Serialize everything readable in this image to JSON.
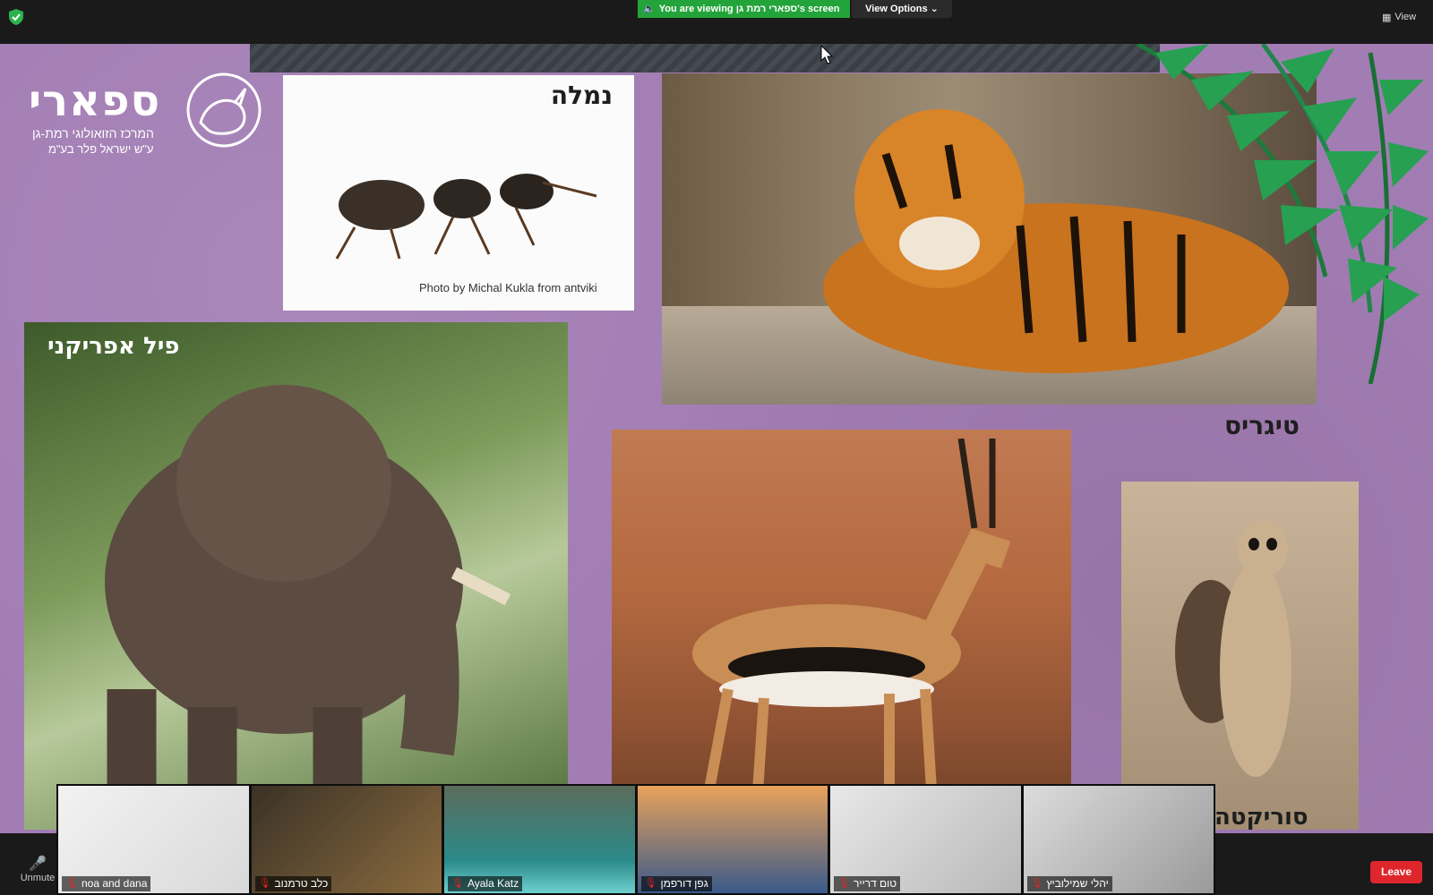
{
  "topbar": {
    "share_banner": "You are viewing ספארי רמת גן's screen",
    "view_options": "View Options",
    "view_label": "View"
  },
  "slide": {
    "logo": {
      "main": "ספארי",
      "sub1": "המרכז הזואולוגי רמת-גן",
      "sub2": "ע\"ש ישראל פלר בע\"מ"
    },
    "ant": {
      "label": "נמלה",
      "credit": "Photo by Michal Kukla from antviki"
    },
    "tiger": {
      "label": "טיגריס"
    },
    "elephant": {
      "label": "פיל אפריקני"
    },
    "meerkat": {
      "label": "סוריקטה"
    }
  },
  "gallery": [
    {
      "name": "noa and dana",
      "muted": true
    },
    {
      "name": "כלב טרמנוב",
      "muted": true
    },
    {
      "name": "Ayala Katz",
      "muted": true
    },
    {
      "name": "גפן דורפמן",
      "muted": true
    },
    {
      "name": "טום דרייר",
      "muted": true
    },
    {
      "name": "יהלי שמילוביץ",
      "muted": true
    }
  ],
  "controls": {
    "unmute_label": "Unmute",
    "leave_label": "Leave"
  },
  "colors": {
    "slide_bg": "#a27db4",
    "share_banner": "#23a43a",
    "leave": "#e0262d"
  }
}
